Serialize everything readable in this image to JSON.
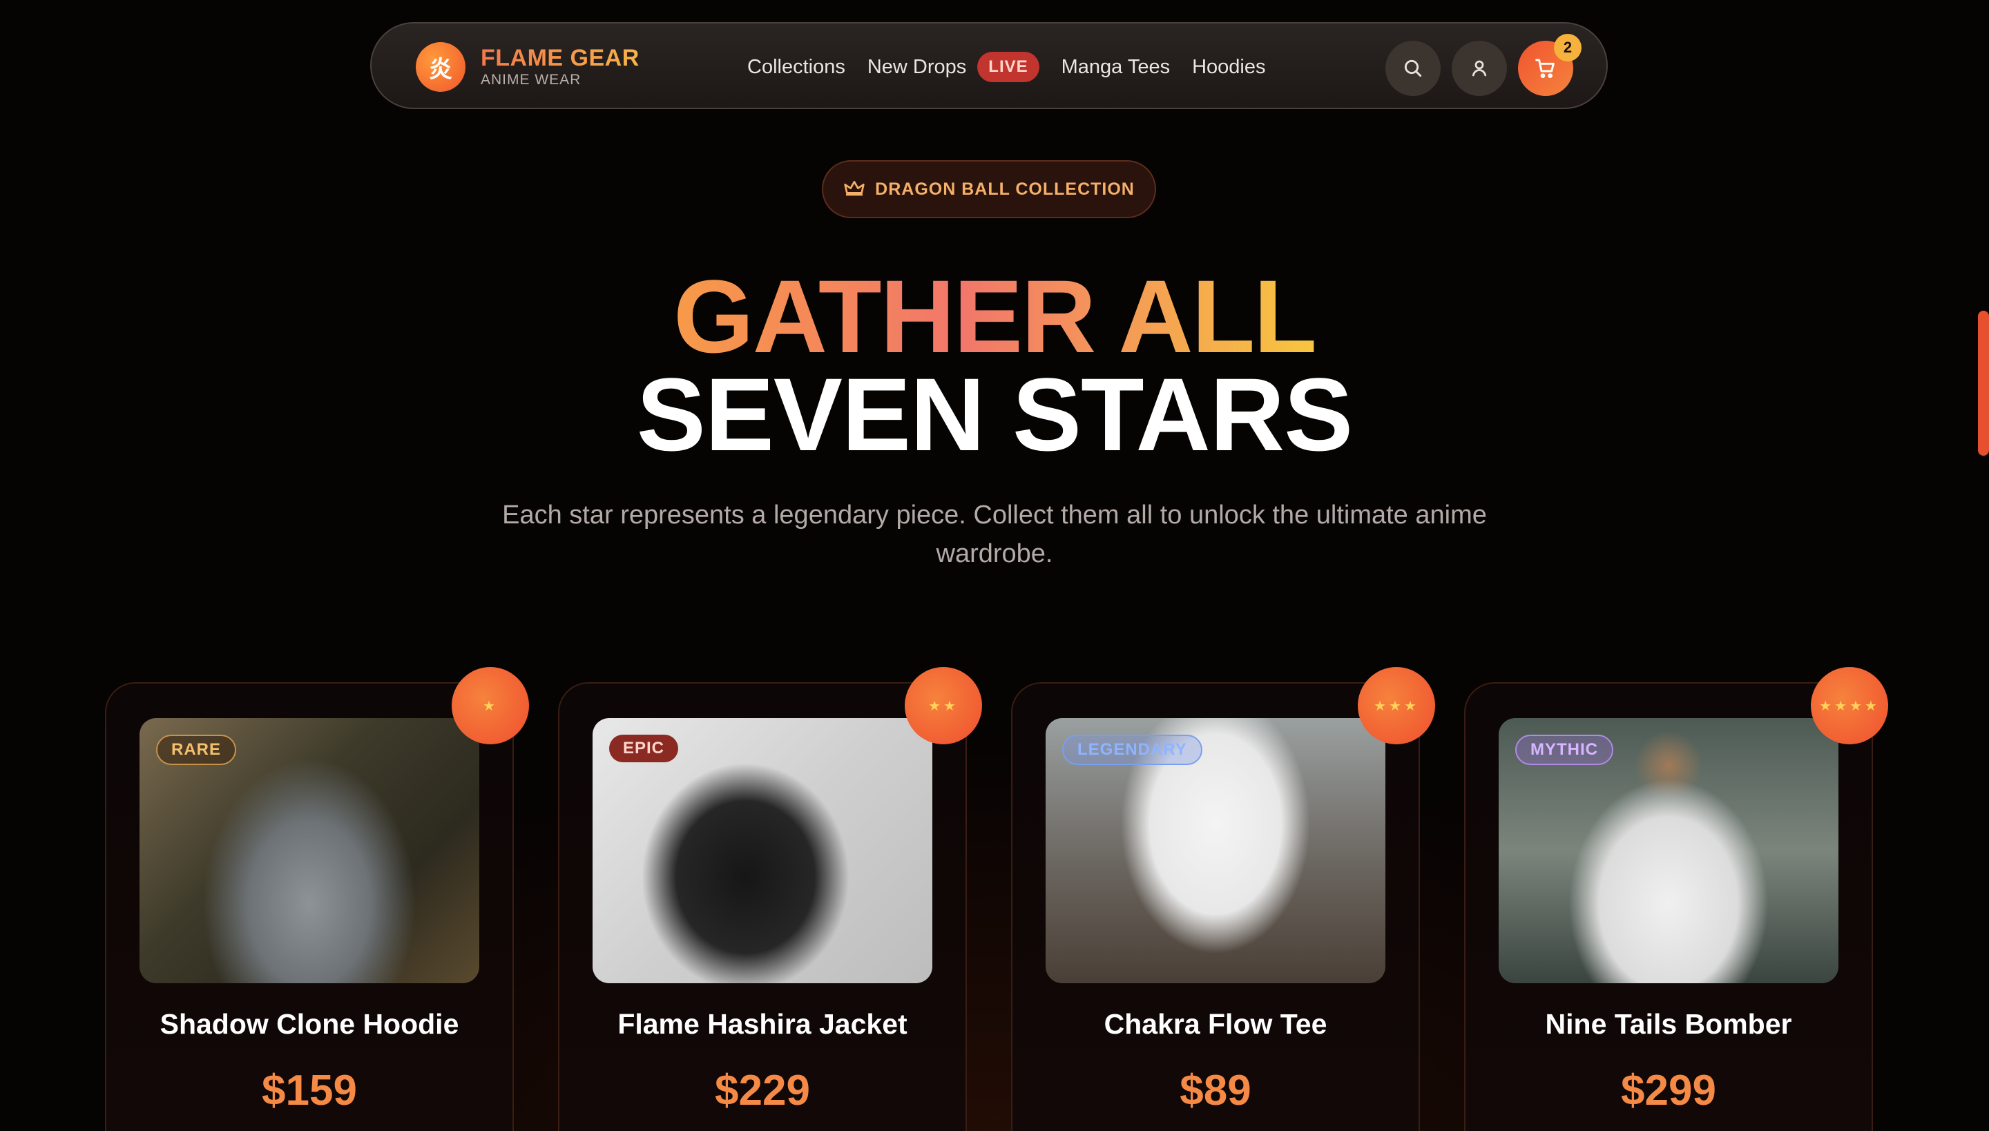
{
  "brand": {
    "logo_glyph": "炎",
    "name": "FLAME GEAR",
    "tagline": "ANIME WEAR"
  },
  "nav": {
    "items": [
      {
        "label": "Collections"
      },
      {
        "label": "New Drops",
        "badge": "LIVE"
      },
      {
        "label": "Manga Tees"
      },
      {
        "label": "Hoodies"
      }
    ],
    "actions": {
      "search_icon": "search-icon",
      "user_icon": "user-icon",
      "cart_icon": "cart-icon",
      "cart_count": "2"
    }
  },
  "hero": {
    "pill_icon": "crown-icon",
    "pill_label": "DRAGON BALL COLLECTION",
    "headline_line1": "GATHER ALL",
    "headline_line2": "SEVEN STARS",
    "subtitle": "Each star represents a legendary piece. Collect them all to unlock the ultimate anime wardrobe."
  },
  "products": [
    {
      "name": "Shadow Clone Hoodie",
      "price": "$159",
      "rarity": "RARE",
      "stars": "★",
      "image": "grey hoodie from behind"
    },
    {
      "name": "Flame Hashira Jacket",
      "price": "$229",
      "rarity": "EPIC",
      "stars": "★★",
      "image": "black leather jacket on hanger"
    },
    {
      "name": "Chakra Flow Tee",
      "price": "$89",
      "rarity": "LEGENDARY",
      "stars": "★★★",
      "image": "white tee from behind"
    },
    {
      "name": "Nine Tails Bomber",
      "price": "$299",
      "rarity": "MYTHIC",
      "stars": "★★★★",
      "image": "white graphic tee from behind"
    }
  ],
  "colors": {
    "accent": "#f0562a",
    "gold": "#f6b23d",
    "background": "#060303"
  }
}
